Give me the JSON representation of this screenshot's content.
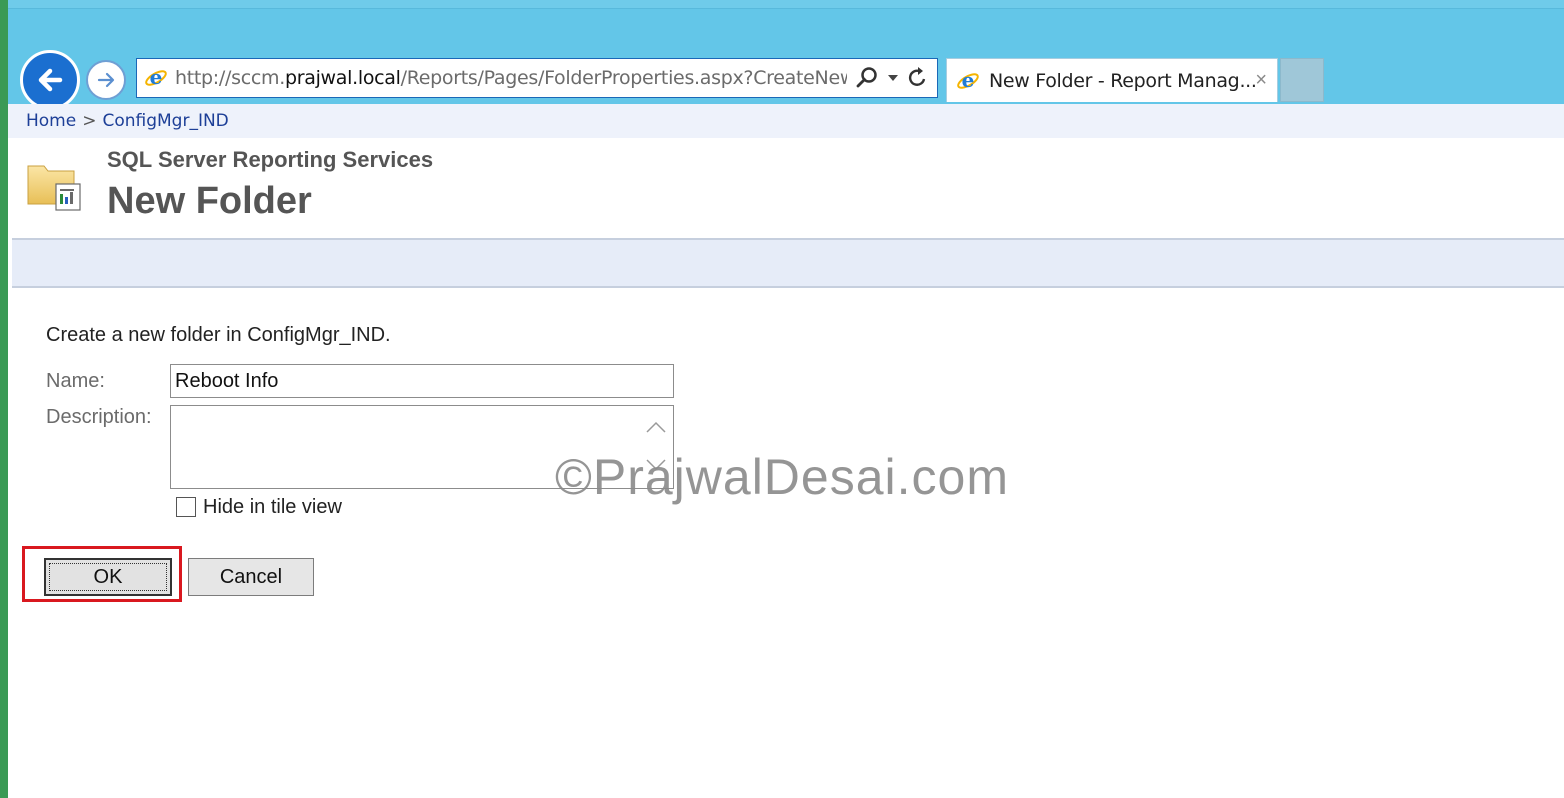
{
  "browser": {
    "url_prefix": "http://sccm.",
    "url_domain": "prajwal.local",
    "url_path": "/Reports/Pages/FolderProperties.aspx?CreateNew=",
    "tab_title": "New Folder - Report Manag...",
    "tab_close": "×",
    "icons": [
      "back-arrow-icon",
      "forward-arrow-icon",
      "ie-logo-icon",
      "search-icon",
      "dropdown-icon",
      "refresh-icon",
      "close-icon"
    ]
  },
  "breadcrumb": {
    "home": "Home",
    "separator": ">",
    "current": "ConfigMgr_IND"
  },
  "header": {
    "app_name": "SQL Server Reporting Services",
    "page_title": "New Folder",
    "icon": "folder-report-icon"
  },
  "form": {
    "intro": "Create a new folder in ConfigMgr_IND.",
    "name_label": "Name:",
    "name_value": "Reboot Info",
    "description_label": "Description:",
    "description_value": "",
    "hide_label": "Hide in tile view",
    "hide_checked": false,
    "ok_label": "OK",
    "cancel_label": "Cancel"
  },
  "watermark": "©PrajwalDesai.com",
  "colors": {
    "chrome": "#63c6e8",
    "link": "#1d3f97",
    "highlight": "#d9181f",
    "band": "#e6ecf8"
  }
}
